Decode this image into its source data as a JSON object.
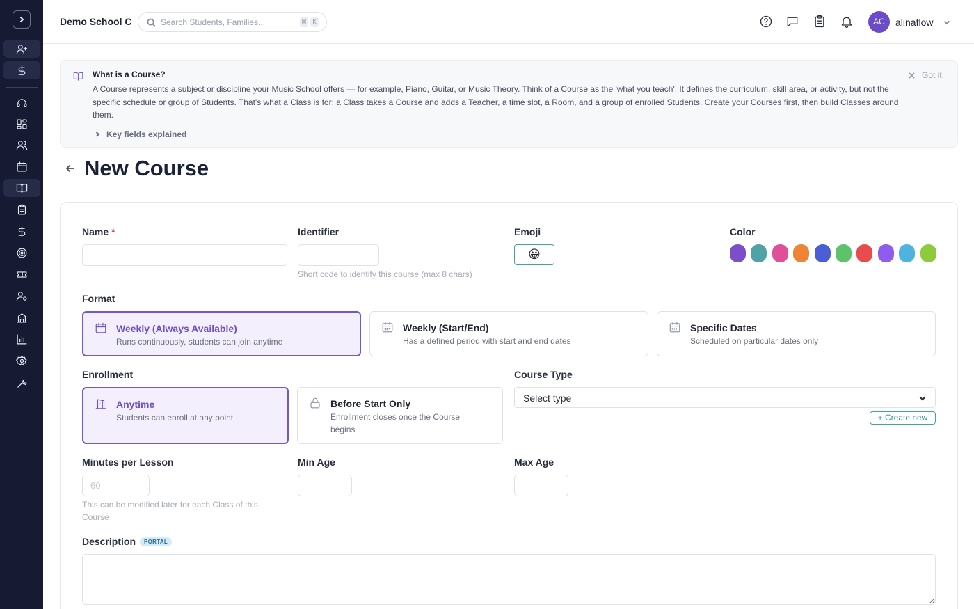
{
  "sidebar": {
    "toggle_icon": "chevron-right-icon",
    "quick_icons": [
      "user-plus-icon",
      "dollar-icon"
    ],
    "nav_icons": [
      "headset-icon",
      "dashboard-grid-icon",
      "users-icon",
      "calendar-icon",
      "book-open-icon",
      "clipboard-icon",
      "dollar-icon",
      "target-icon",
      "ticket-icon",
      "user-cog-icon",
      "building-icon",
      "bar-chart-icon",
      "settings-gear-icon",
      "wrench-icon"
    ],
    "active_item": "book-open-icon"
  },
  "header": {
    "school_name": "Demo School C",
    "search_placeholder": "Search Students, Families...",
    "search_shortcut": [
      "⌘",
      "K"
    ],
    "icons": [
      "help-icon",
      "chat-icon",
      "clipboard-icon",
      "bell-icon"
    ],
    "user": {
      "initials": "AC",
      "name": "alinaflow"
    }
  },
  "banner": {
    "title": "What is a Course?",
    "body": "A Course represents a subject or discipline your Music School offers — for example, Piano, Guitar, or Music Theory. Think of a Course as the 'what you teach'. It defines the curriculum, skill area, or activity, but not the specific schedule or group of Students. That's what a Class is for: a Class takes a Course and adds a Teacher, a time slot, a Room, and a group of enrolled Students. Create your Courses first, then build Classes around them.",
    "key_fields_label": "Key fields explained",
    "dismiss_label": "Got it"
  },
  "page": {
    "title": "New Course"
  },
  "form": {
    "name_label": "Name",
    "name_required_mark": "*",
    "name_value": "",
    "identifier_label": "Identifier",
    "identifier_value": "",
    "identifier_hint": "Short code to identify this course (max 8 chars)",
    "emoji_label": "Emoji",
    "emoji_value": "😀",
    "color_label": "Color",
    "colors": [
      "#7b4fc9",
      "#4fa3a5",
      "#e0509a",
      "#ee8436",
      "#4a5fd6",
      "#5cc36a",
      "#e84c4c",
      "#8f5cf0",
      "#4fb3e0",
      "#8ccc3c"
    ],
    "format_label": "Format",
    "format_options": [
      {
        "title": "Weekly (Always Available)",
        "desc": "Runs continuously, students can join anytime",
        "selected": true,
        "icon": "calendar-icon"
      },
      {
        "title": "Weekly (Start/End)",
        "desc": "Has a defined period with start and end dates",
        "selected": false,
        "icon": "calendar-range-icon"
      },
      {
        "title": "Specific Dates",
        "desc": "Scheduled on particular dates only",
        "selected": false,
        "icon": "calendar-dates-icon"
      }
    ],
    "enrollment_label": "Enrollment",
    "enrollment_options": [
      {
        "title": "Anytime",
        "desc": "Students can enroll at any point",
        "selected": true,
        "icon": "door-open-icon"
      },
      {
        "title": "Before Start Only",
        "desc": "Enrollment closes once the Course begins",
        "selected": false,
        "icon": "lock-icon"
      }
    ],
    "course_type_label": "Course Type",
    "course_type_value": "Select type",
    "create_new_label": "+ Create new",
    "minutes_label": "Minutes per Lesson",
    "minutes_placeholder": "60",
    "minutes_hint": "This can be modified later for each Class of this Course",
    "min_age_label": "Min Age",
    "min_age_value": "",
    "max_age_label": "Max Age",
    "max_age_value": "",
    "description_label": "Description",
    "description_badge": "PORTAL",
    "description_value": ""
  }
}
